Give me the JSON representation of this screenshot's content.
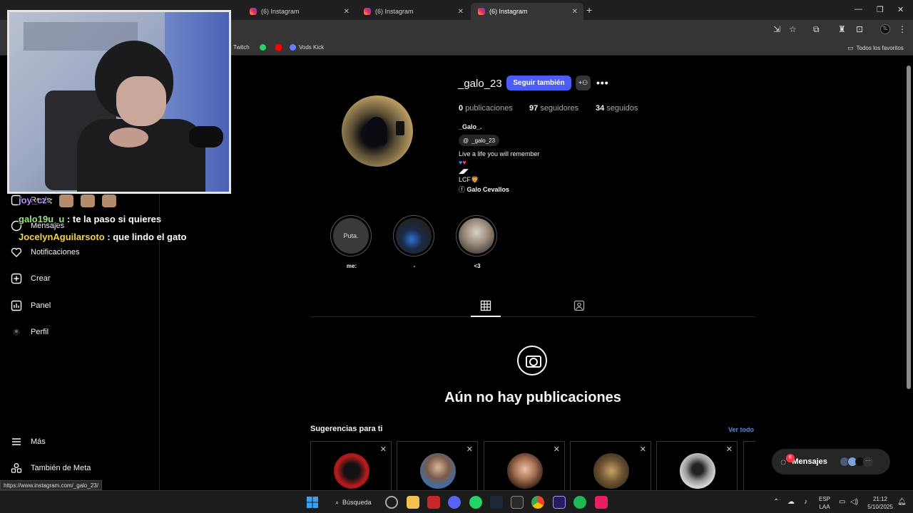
{
  "browser": {
    "tabs": [
      {
        "label": "(6) Instagram"
      },
      {
        "label": "(6) Instagram"
      },
      {
        "label": "(6) Instagram"
      }
    ],
    "bookmarks": {
      "twitch": "Twitch",
      "vods_kick": "Vods Kick",
      "favorites": "Todos los favoritos"
    },
    "status_url": "https://www.instagram.com/_galo_23/"
  },
  "sidenav": {
    "items": [
      {
        "label": "Reels"
      },
      {
        "label": "Mensajes"
      },
      {
        "label": "Notificaciones"
      },
      {
        "label": "Crear"
      },
      {
        "label": "Panel"
      },
      {
        "label": "Perfil"
      },
      {
        "label": "Más"
      },
      {
        "label": "También de Meta"
      }
    ]
  },
  "chat": [
    {
      "user": "joy_cz",
      "text": ""
    },
    {
      "user": "galo19u_u",
      "text": ": te la paso si quieres"
    },
    {
      "user": "JocelynAguilarsoto",
      "text": ": que lindo el gato"
    }
  ],
  "chat_sep": ":",
  "profile": {
    "username": "_galo_23",
    "follow_button": "Seguir también",
    "stats": {
      "posts_count": "0",
      "posts_label": "publicaciones",
      "followers_count": "97",
      "followers_label": "seguidores",
      "following_count": "34",
      "following_label": "seguidos"
    },
    "display_name": "_Galo_.",
    "threads_handle": "_galo_23",
    "bio_line1": "Live a life you will remember",
    "bio_line3": "◢◤",
    "bio_line4": "LCF🦁",
    "bio_link": "Galo Cevallos",
    "highlights": [
      {
        "label": "me:",
        "thumb_text": "Puta."
      },
      {
        "label": "-"
      },
      {
        "label": "<3"
      }
    ]
  },
  "empty_state": {
    "title": "Aún no hay publicaciones"
  },
  "suggestions": {
    "title": "Sugerencias para ti",
    "see_all": "Ver todo"
  },
  "messages": {
    "label": "Mensajes",
    "badge": "6"
  },
  "taskbar": {
    "search": "Búsqueda",
    "lang_top": "ESP",
    "lang_bottom": "LAA",
    "time": "21:12",
    "date": "5/10/2025"
  }
}
